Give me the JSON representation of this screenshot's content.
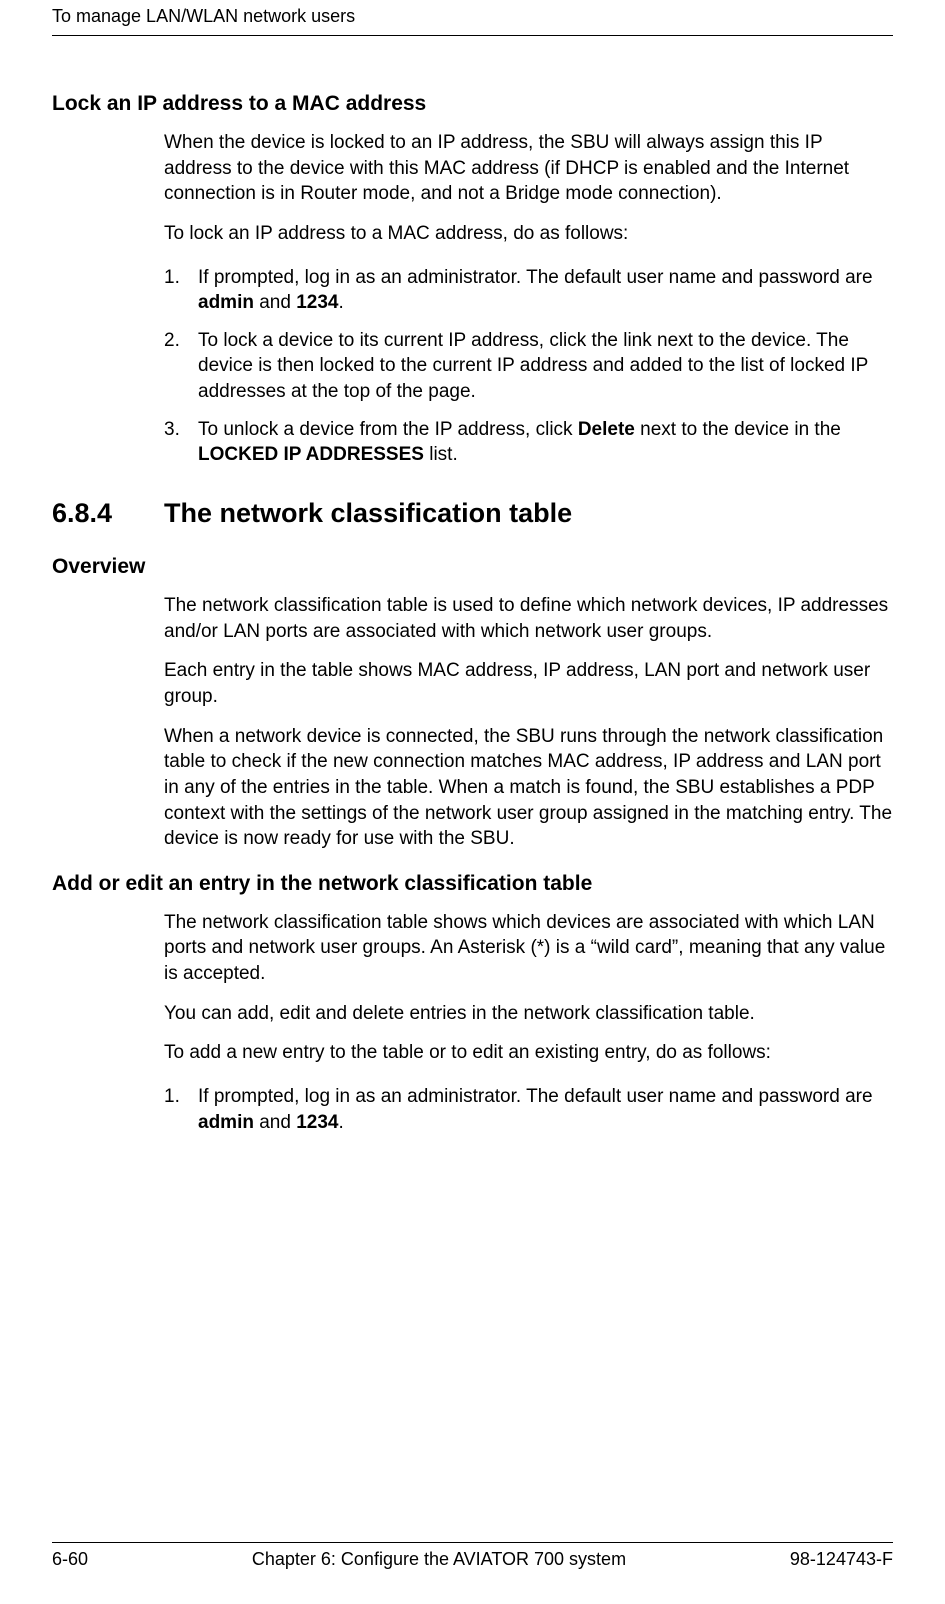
{
  "header": {
    "running": "To manage LAN/WLAN network users"
  },
  "sec1": {
    "title": "Lock an IP address to a MAC address",
    "p1": "When the device is locked to an IP address, the SBU will always assign this IP address to the device with this MAC address (if DHCP is enabled and the Internet connection is in Router mode, and not a Bridge mode connection).",
    "p2": "To lock an IP address to a MAC address, do as follows:",
    "li1_a": "If prompted, log in as an administrator. The default user name and password are ",
    "li1_b": "admin",
    "li1_c": " and ",
    "li1_d": "1234",
    "li1_e": ".",
    "li2": "To lock a device to its current IP address, click the link next to the device. The device is then locked to the current IP address and added to the list of locked IP addresses at the top of the page.",
    "li3_a": "To unlock a device from the IP address, click ",
    "li3_b": "Delete",
    "li3_c": " next to the device in the ",
    "li3_d": "LOCKED IP ADDRESSES",
    "li3_e": " list."
  },
  "sec2": {
    "num": "6.8.4",
    "title": "The network classification table",
    "ov_title": "Overview",
    "ov_p1": "The network classification table is used to define which network devices, IP addresses and/or LAN ports are associated with which network user groups.",
    "ov_p2": "Each entry in the table shows MAC address, IP address, LAN port and network user group.",
    "ov_p3": "When a network device is connected, the SBU runs through the network classification table to check if the new connection matches MAC address, IP address and LAN port in any of the entries in the table. When a match is found, the SBU establishes a PDP context with the settings of the network user group assigned in the matching entry. The device is now ready for use with the SBU.",
    "ae_title": "Add or edit an entry in the network classification table",
    "ae_p1": "The network classification table shows which devices are associated with which LAN ports and network user groups. An Asterisk (*) is a “wild card”, meaning that any value is accepted.",
    "ae_p2": "You can add, edit and delete entries in the network classification table.",
    "ae_p3": "To add a new entry to the table or to edit an existing entry, do as follows:",
    "ae_li1_a": "If prompted, log in as an administrator. The default user name and password are ",
    "ae_li1_b": "admin",
    "ae_li1_c": " and ",
    "ae_li1_d": "1234",
    "ae_li1_e": "."
  },
  "footer": {
    "left": "6-60",
    "center": "Chapter 6:  Configure the AVIATOR 700 system",
    "right": "98-124743-F"
  }
}
